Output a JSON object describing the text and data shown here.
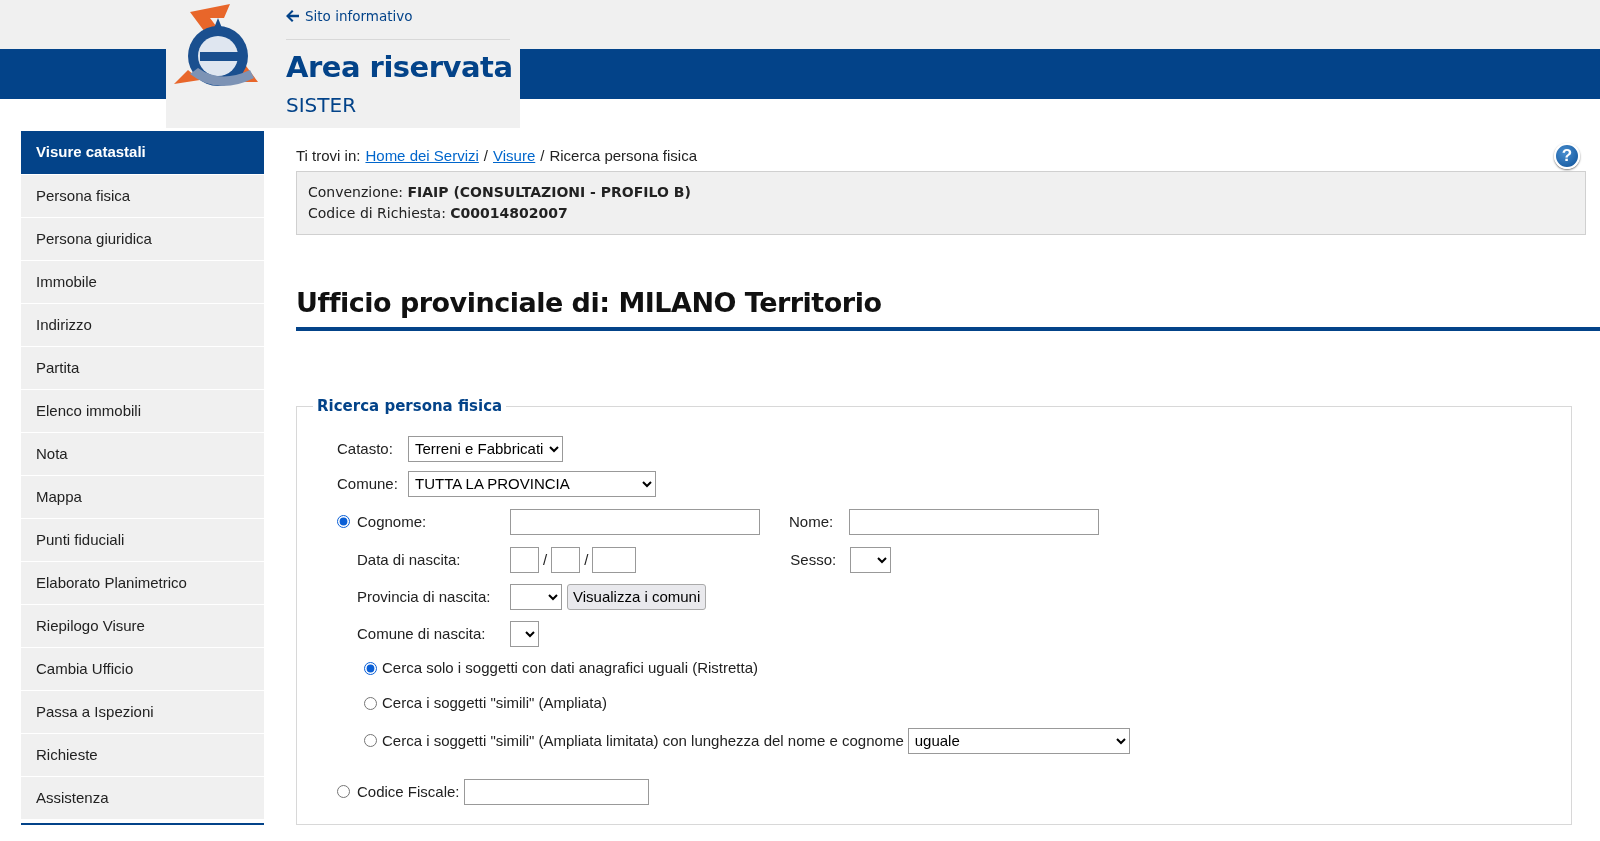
{
  "header": {
    "back_link": "Sito informativo",
    "title": "Area riservata",
    "subtitle": "SISTER"
  },
  "sidebar": {
    "heading": "Visure catastali",
    "items": [
      {
        "label": "Persona fisica"
      },
      {
        "label": "Persona giuridica"
      },
      {
        "label": "Immobile"
      },
      {
        "label": "Indirizzo"
      },
      {
        "label": "Partita"
      },
      {
        "label": "Elenco immobili"
      },
      {
        "label": "Nota"
      },
      {
        "label": "Mappa"
      },
      {
        "label": "Punti fiduciali"
      },
      {
        "label": "Elaborato Planimetrico"
      },
      {
        "label": "Riepilogo Visure"
      },
      {
        "label": "Cambia Ufficio"
      },
      {
        "label": "Passa a Ispezioni"
      },
      {
        "label": "Richieste"
      },
      {
        "label": "Assistenza"
      }
    ]
  },
  "breadcrumb": {
    "prefix": "Ti trovi in:",
    "items": [
      {
        "kind": "link",
        "text": "Home dei Servizi"
      },
      {
        "kind": "separator",
        "text": "/"
      },
      {
        "kind": "link",
        "text": "Visure"
      },
      {
        "kind": "separator",
        "text": "/"
      },
      {
        "kind": "current",
        "text": "Ricerca persona fisica"
      }
    ]
  },
  "help_button": "?",
  "info": [
    {
      "label": "Convenzione:",
      "value": "FIAIP (CONSULTAZIONI - PROFILO B)"
    },
    {
      "label": "Codice di Richiesta:",
      "value": "C00014802007"
    }
  ],
  "heading": "Ufficio provinciale di: MILANO Territorio",
  "form": {
    "legend": "Ricerca persona fisica",
    "catasto": {
      "label": "Catasto:",
      "value": "Terreni e Fabbricati"
    },
    "comune": {
      "label": "Comune:",
      "value": "TUTTA LA PROVINCIA"
    },
    "by_name": {
      "selected": true,
      "cognome": {
        "label": "Cognome:"
      },
      "nome": {
        "label": "Nome:"
      },
      "data_nascita": {
        "label": "Data di nascita:",
        "separators": [
          "/",
          "/"
        ]
      },
      "sesso": {
        "label": "Sesso:"
      },
      "provincia_nascita": {
        "label": "Provincia di nascita:",
        "button": "Visualizza i comuni"
      },
      "comune_nascita": {
        "label": "Comune di nascita:"
      },
      "search_options": [
        {
          "label": "Cerca solo i soggetti con dati anagrafici uguali (Ristretta)",
          "selected": true
        },
        {
          "label": "Cerca i soggetti \"simili\" (Ampliata)",
          "selected": false
        },
        {
          "label": "Cerca i soggetti \"simili\" (Ampliata limitata) con lunghezza del nome e cognome",
          "selected": false,
          "select_value": "uguale"
        }
      ]
    },
    "codice_fiscale": {
      "label": "Codice Fiscale:",
      "selected": false
    }
  }
}
